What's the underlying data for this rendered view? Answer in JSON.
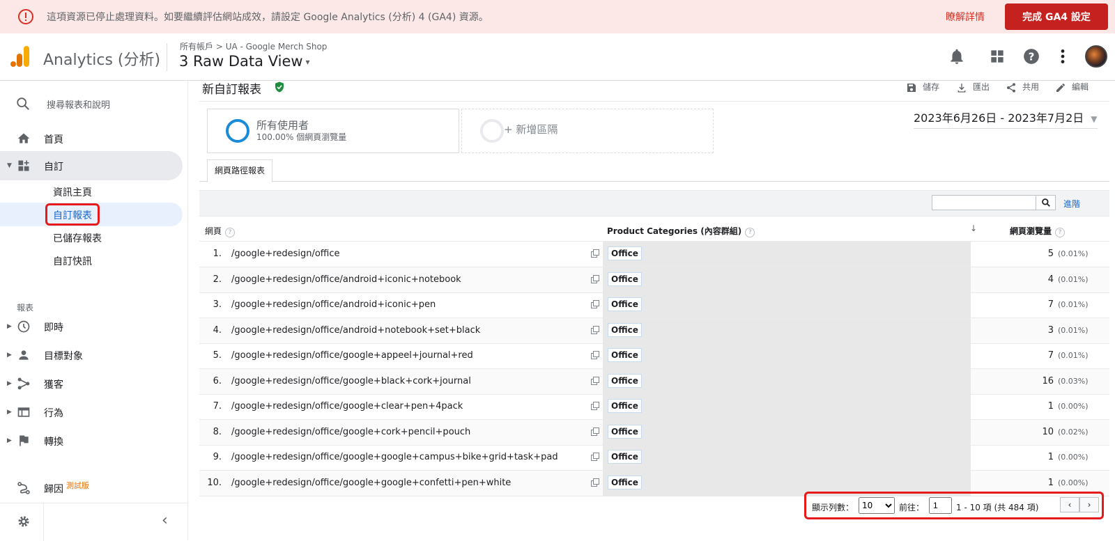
{
  "banner": {
    "message": "這項資源已停止處理資料。如要繼續評估網站成效，請設定 Google Analytics (分析) 4 (GA4) 資源。",
    "learn_more": "瞭解詳情",
    "cta": "完成 GA4 設定",
    "color": "#c5221f"
  },
  "header": {
    "app_name": "Analytics (分析)",
    "breadcrumb_root": "所有帳戶",
    "breadcrumb_sep": ">",
    "breadcrumb_account": "UA - Google Merch Shop",
    "view_name": "3 Raw Data View",
    "caret": "▾",
    "icons": [
      "bell-icon",
      "apps-icon",
      "help-icon",
      "more-vert-icon"
    ]
  },
  "sidebar": {
    "search_placeholder": "搜尋報表和說明",
    "home": "首頁",
    "customization": "自訂",
    "sub_items": [
      "資訊主頁",
      "自訂報表",
      "已儲存報表",
      "自訂快訊"
    ],
    "reports_section": "報表",
    "report_items": [
      "即時",
      "目標對象",
      "獲客",
      "行為",
      "轉換"
    ],
    "attribution": "歸因",
    "beta": "測試版",
    "collapse": "‹"
  },
  "main": {
    "title": "新自訂報表",
    "actions": [
      "儲存",
      "匯出",
      "共用",
      "編輯"
    ],
    "segment_name": "所有使用者",
    "segment_stat": "100.00% 個網頁瀏覽量",
    "add_segment": "+ 新增區隔",
    "date_range": "2023年6月26日 - 2023年7月2日",
    "tab": "網頁路徑報表",
    "advanced": "進階",
    "columns": {
      "page": "網頁",
      "category": "Product Categories (內容群組)",
      "pageviews": "網頁瀏覽量"
    },
    "help_glyph": "?",
    "sort_glyph": "↓",
    "rows": [
      {
        "num": "1.",
        "path": "/google+redesign/office",
        "cat": "Office",
        "pv": "5",
        "pct": "(0.01%)"
      },
      {
        "num": "2.",
        "path": "/google+redesign/office/android+iconic+notebook",
        "cat": "Office",
        "pv": "4",
        "pct": "(0.01%)"
      },
      {
        "num": "3.",
        "path": "/google+redesign/office/android+iconic+pen",
        "cat": "Office",
        "pv": "7",
        "pct": "(0.01%)"
      },
      {
        "num": "4.",
        "path": "/google+redesign/office/android+notebook+set+black",
        "cat": "Office",
        "pv": "3",
        "pct": "(0.01%)"
      },
      {
        "num": "5.",
        "path": "/google+redesign/office/google+appeel+journal+red",
        "cat": "Office",
        "pv": "7",
        "pct": "(0.01%)"
      },
      {
        "num": "6.",
        "path": "/google+redesign/office/google+black+cork+journal",
        "cat": "Office",
        "pv": "16",
        "pct": "(0.03%)"
      },
      {
        "num": "7.",
        "path": "/google+redesign/office/google+clear+pen+4pack",
        "cat": "Office",
        "pv": "1",
        "pct": "(0.00%)"
      },
      {
        "num": "8.",
        "path": "/google+redesign/office/google+cork+pencil+pouch",
        "cat": "Office",
        "pv": "10",
        "pct": "(0.02%)"
      },
      {
        "num": "9.",
        "path": "/google+redesign/office/google+google+campus+bike+grid+task+pad",
        "cat": "Office",
        "pv": "1",
        "pct": "(0.00%)"
      },
      {
        "num": "10.",
        "path": "/google+redesign/office/google+google+confetti+pen+white",
        "cat": "Office",
        "pv": "1",
        "pct": "(0.00%)"
      }
    ],
    "pager": {
      "rows_label": "顯示列數：",
      "rows_value": "10",
      "goto_label": "前往：",
      "goto_value": "1",
      "range": "1 - 10 項 (共 484 項)",
      "prev": "‹",
      "next": "›"
    }
  }
}
